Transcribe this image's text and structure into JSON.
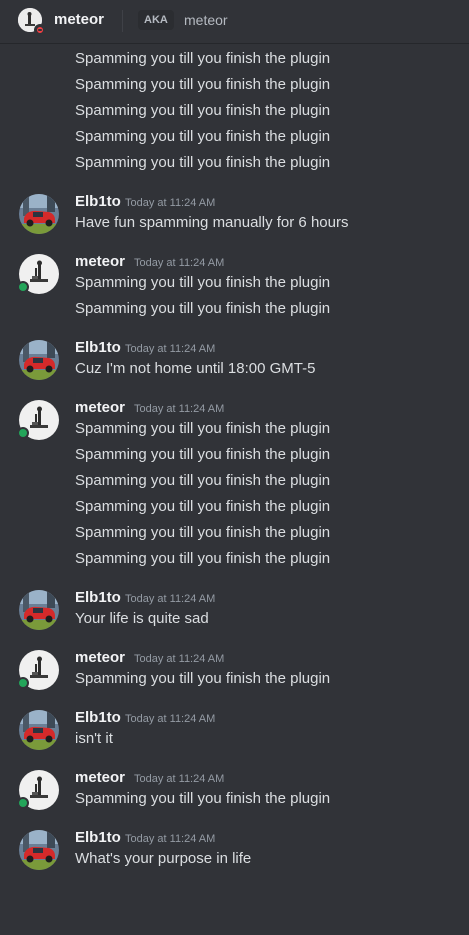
{
  "header": {
    "name": "meteor",
    "aka_label": "AKA",
    "aka_name": "meteor"
  },
  "messages": {
    "top_lines": [
      "Spamming you till you finish the plugin",
      "Spamming you till you finish the plugin",
      "Spamming you till you finish the plugin",
      "Spamming you till you finish the plugin",
      "Spamming you till you finish the plugin"
    ],
    "groups": [
      {
        "author": "Elb1to",
        "timestamp": "Today at 11:24 AM",
        "lines": [
          "Have fun spamming manually for 6 hours"
        ]
      },
      {
        "author": "meteor",
        "timestamp": "Today at 11:24 AM",
        "lines": [
          "Spamming you till you finish the plugin",
          "Spamming you till you finish the plugin"
        ]
      },
      {
        "author": "Elb1to",
        "timestamp": "Today at 11:24 AM",
        "lines": [
          "Cuz I'm not home until 18:00 GMT-5"
        ]
      },
      {
        "author": "meteor",
        "timestamp": "Today at 11:24 AM",
        "lines": [
          "Spamming you till you finish the plugin",
          "Spamming you till you finish the plugin",
          "Spamming you till you finish the plugin",
          "Spamming you till you finish the plugin",
          "Spamming you till you finish the plugin",
          "Spamming you till you finish the plugin"
        ]
      },
      {
        "author": "Elb1to",
        "timestamp": "Today at 11:24 AM",
        "lines": [
          "Your life is quite sad"
        ]
      },
      {
        "author": "meteor",
        "timestamp": "Today at 11:24 AM",
        "lines": [
          "Spamming you till you finish the plugin"
        ]
      },
      {
        "author": "Elb1to",
        "timestamp": "Today at 11:24 AM",
        "lines": [
          "isn't it"
        ]
      },
      {
        "author": "meteor",
        "timestamp": "Today at 11:24 AM",
        "lines": [
          "Spamming you till you finish the plugin"
        ]
      },
      {
        "author": "Elb1to",
        "timestamp": "Today at 11:24 AM",
        "lines": [
          "What's your purpose in life"
        ]
      }
    ]
  },
  "colors": {
    "background": "#313338",
    "text": "#dbdee1",
    "author": "#f2f3f5",
    "muted": "#949ba4",
    "online": "#23a55a",
    "dnd": "#f23f43"
  }
}
